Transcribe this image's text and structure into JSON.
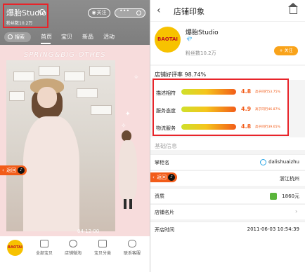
{
  "left": {
    "header": {
      "shop_name": "爆胎Studio",
      "fans": "粉丝数10.2万",
      "follow": "关注",
      "more_dots": "•••",
      "search": "搜索"
    },
    "tabs": [
      "首页",
      "宝贝",
      "新品",
      "活动"
    ],
    "banner": {
      "title": "SPRING&BIG-OTHES",
      "date": "04·12·00",
      "back_label": "返回",
      "back_arrow": "‹",
      "tiktok_glyph": "♪"
    },
    "bottom_tabs": [
      {
        "label": "全部宝贝",
        "icon": "bag-icon"
      },
      {
        "label": "店铺微淘",
        "icon": "eye-icon"
      },
      {
        "label": "宝贝分类",
        "icon": "grid-icon"
      },
      {
        "label": "联系客服",
        "icon": "chat-icon"
      }
    ],
    "logo_text": "BAOTAI"
  },
  "right": {
    "back_arrow": "‹",
    "title": "店铺印象",
    "shop": {
      "logo_text": "BAOTAI",
      "name": "爆胎Studio",
      "badge": "💎",
      "fans": "粉丝数10.2万",
      "follow": "+ 关注"
    },
    "rating": "店铺好评率 98.74%",
    "metrics": [
      {
        "label": "描述相符",
        "score": "4.8",
        "compare": "高于同行53.75%"
      },
      {
        "label": "服务态度",
        "score": "4.9",
        "compare": "高于同行46.87%"
      },
      {
        "label": "物流服务",
        "score": "4.8",
        "compare": "高于同行39.65%"
      }
    ],
    "basic_title": "基础信息",
    "info": {
      "owner_label": "掌柜名",
      "owner_value": "dalishuaizhu",
      "location_value": "浙江杭州",
      "asset_label": "资质",
      "asset_value": "1860元",
      "card_label": "店铺名片",
      "card_chevron": "›",
      "opened_label": "开店时间",
      "opened_value": "2011-06-03 10:54:39"
    },
    "back_label": "返回",
    "tiktok_glyph": "♪"
  },
  "colors": {
    "accent": "#f25c19",
    "highlight": "#e8242a",
    "brand": "#f7c200"
  }
}
